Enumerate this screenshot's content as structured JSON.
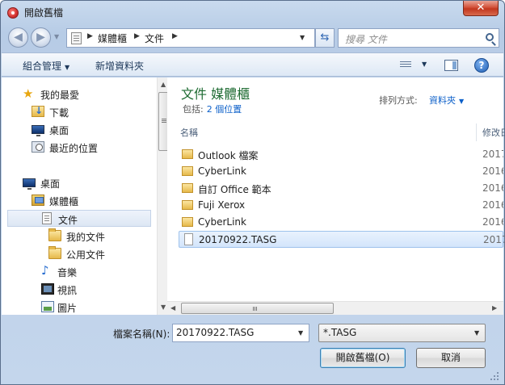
{
  "window": {
    "title": "開啟舊檔",
    "close_label": "✕"
  },
  "navbar": {
    "breadcrumb": [
      "媒體櫃",
      "文件"
    ],
    "search_placeholder": "搜尋 文件"
  },
  "toolbar": {
    "organize_label": "組合管理",
    "new_folder_label": "新增資料夾",
    "help_label": "?"
  },
  "sidebar": {
    "favorites": {
      "label": "我的最愛",
      "items": [
        {
          "label": "下載",
          "icon": "download-folder-icon"
        },
        {
          "label": "桌面",
          "icon": "desktop-icon"
        },
        {
          "label": "最近的位置",
          "icon": "recent-places-icon"
        }
      ]
    },
    "desktop": {
      "label": "桌面",
      "icon": "desktop-icon"
    },
    "libraries": {
      "label": "媒體櫃",
      "icon": "library-icon"
    },
    "library_items": [
      {
        "label": "文件",
        "icon": "documents-icon",
        "selected": true
      },
      {
        "label": "我的文件",
        "icon": "folder-icon",
        "indent": true
      },
      {
        "label": "公用文件",
        "icon": "folder-icon",
        "indent": true
      },
      {
        "label": "音樂",
        "icon": "music-icon"
      },
      {
        "label": "視訊",
        "icon": "video-icon"
      },
      {
        "label": "圖片",
        "icon": "pictures-icon"
      }
    ]
  },
  "main": {
    "library_title": "文件 媒體櫃",
    "includes_label": "包括:",
    "includes_link": "2 個位置",
    "sort_label": "排列方式:",
    "sort_value": "資料夾",
    "columns": {
      "name": "名稱",
      "date": "修改日期"
    },
    "files": [
      {
        "name": "Outlook 檔案",
        "date": "2017",
        "type": "folder",
        "selected": false
      },
      {
        "name": "CyberLink",
        "date": "2016",
        "type": "folder",
        "selected": false
      },
      {
        "name": "自訂 Office 範本",
        "date": "2016",
        "type": "folder",
        "selected": false
      },
      {
        "name": "Fuji Xerox",
        "date": "2016",
        "type": "folder",
        "selected": false
      },
      {
        "name": "CyberLink",
        "date": "2016",
        "type": "folder",
        "selected": false
      },
      {
        "name": "20170922.TASG",
        "date": "2017",
        "type": "file",
        "selected": true
      }
    ]
  },
  "bottom": {
    "filename_label": "檔案名稱(N):",
    "filename_value": "20170922.TASG",
    "filetype_value": "*.TASG",
    "open_label": "開啟舊檔(O)",
    "cancel_label": "取消"
  }
}
